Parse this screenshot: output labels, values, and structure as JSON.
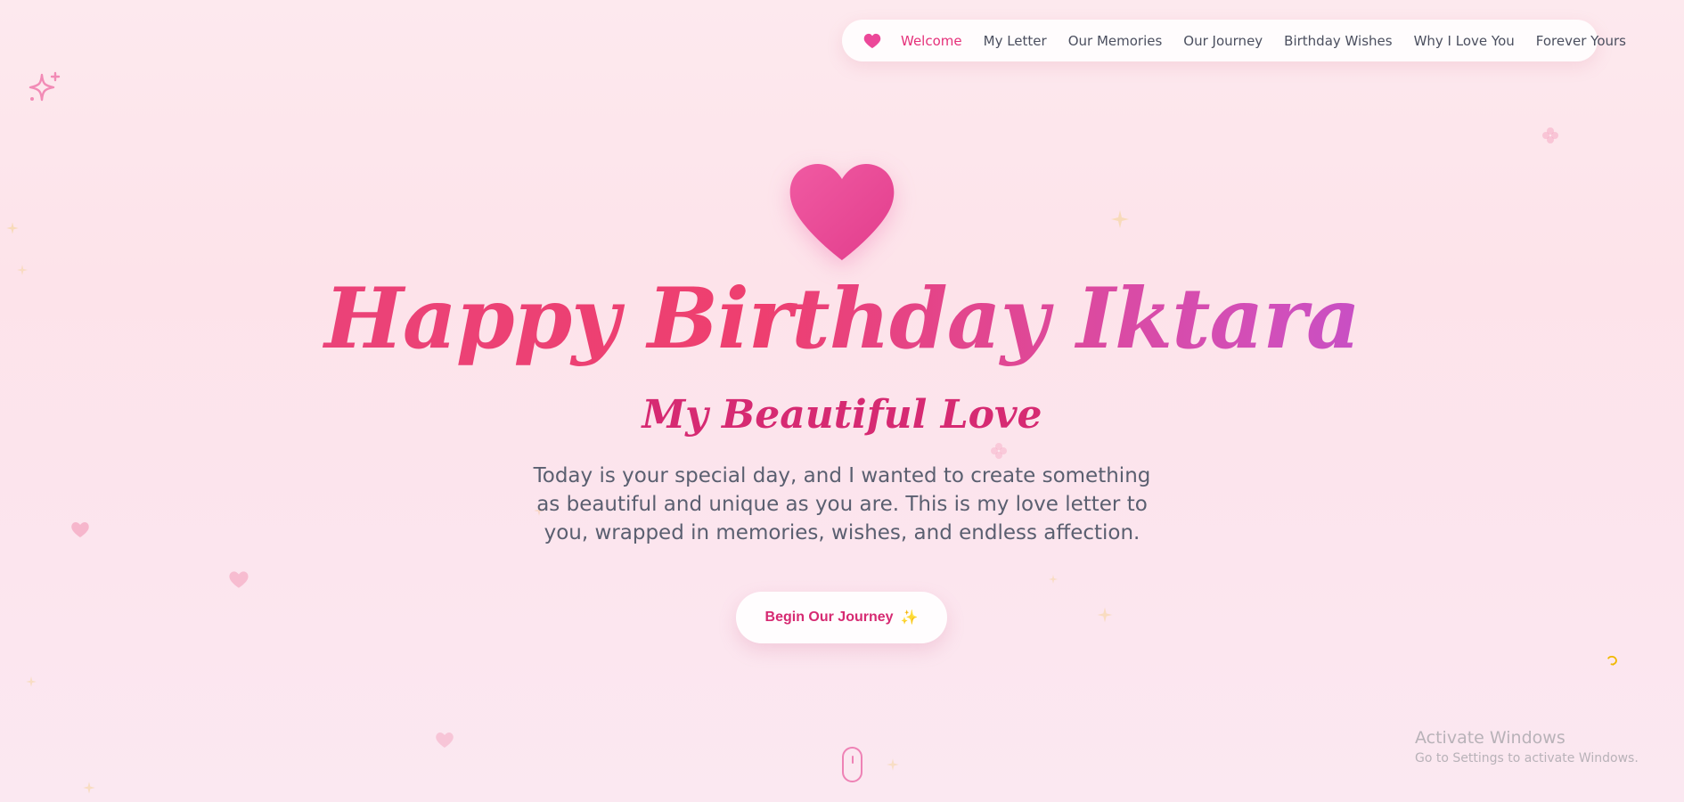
{
  "nav": {
    "logo_icon": "heart-icon",
    "items": [
      {
        "label": "Welcome",
        "active": true
      },
      {
        "label": "My Letter",
        "active": false
      },
      {
        "label": "Our Memories",
        "active": false
      },
      {
        "label": "Our Journey",
        "active": false
      },
      {
        "label": "Birthday Wishes",
        "active": false
      },
      {
        "label": "Why I Love You",
        "active": false
      },
      {
        "label": "Forever Yours",
        "active": false
      }
    ]
  },
  "hero": {
    "heart_icon": "heart-icon",
    "title": "Happy Birthday Iktara",
    "subtitle": "My Beautiful Love",
    "intro": "Today is your special day, and I wanted to create something as beautiful and unique as you are. This is my love letter to you, wrapped in memories, wishes, and endless affection.",
    "cta_label": "Begin Our Journey",
    "cta_icon": "sparkles-icon"
  },
  "decorations": {
    "corner_icon": "sparkle-icon",
    "scroll_icon": "mouse-scroll-icon"
  },
  "watermark": {
    "title": "Activate Windows",
    "subtitle": "Go to Settings to activate Windows."
  },
  "colors": {
    "accent": "#e5317a",
    "heart": "#ec4899",
    "subtitle": "#d62a72",
    "body_text": "#5a5f70",
    "gradient_end": "#a64fea"
  }
}
